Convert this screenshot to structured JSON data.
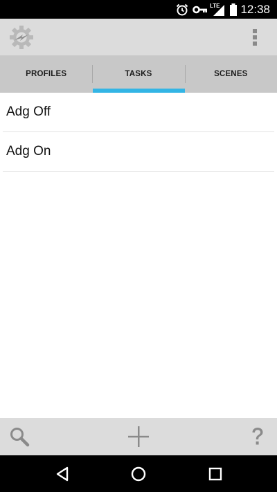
{
  "status_bar": {
    "time": "12:38",
    "network_label": "LTE",
    "icons": [
      "alarm-icon",
      "vpn-key-icon",
      "signal-icon",
      "battery-icon"
    ]
  },
  "action_bar": {
    "logo_icon": "tasker-gear-logo-icon",
    "menu_icon": "overflow-menu-icon"
  },
  "tabs": [
    {
      "label": "PROFILES",
      "selected": false
    },
    {
      "label": "TASKS",
      "selected": true
    },
    {
      "label": "SCENES",
      "selected": false
    }
  ],
  "colors": {
    "tab_indicator": "#33b5e5",
    "action_bar": "#dcdcdc",
    "tab_bar": "#c8c8c8"
  },
  "tasks": [
    {
      "name": "Adg Off"
    },
    {
      "name": "Adg On"
    }
  ],
  "bottom_toolbar": {
    "icons": [
      "search-icon",
      "add-icon",
      "help-icon"
    ]
  },
  "nav_bar": {
    "icons": [
      "back-icon",
      "home-icon",
      "recents-icon"
    ]
  }
}
